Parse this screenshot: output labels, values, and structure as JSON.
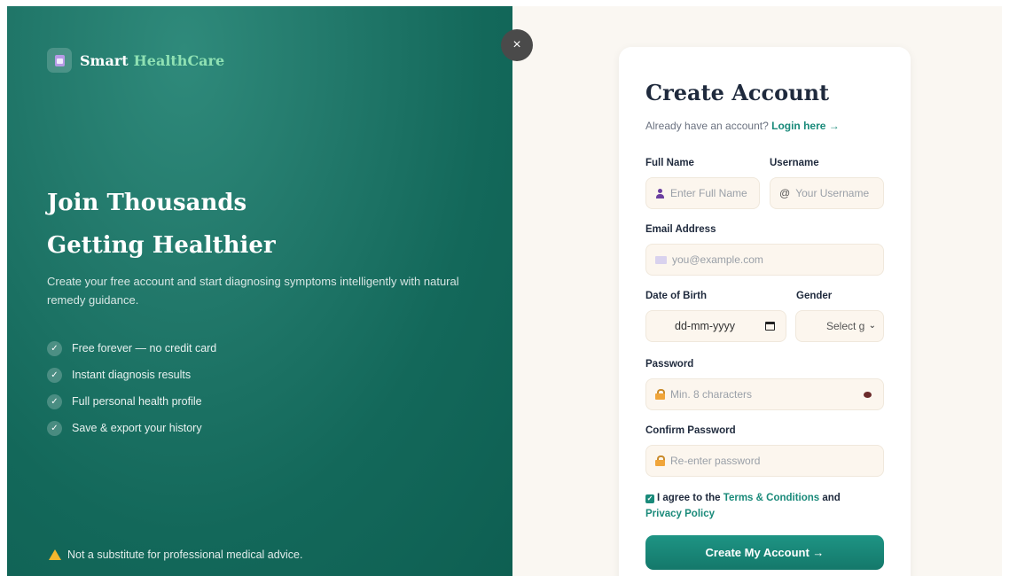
{
  "brand": {
    "name_part1": "Smart",
    "name_part2": "HealthCare"
  },
  "hero": {
    "title_line1": "Join Thousands",
    "title_line2": "Getting Healthier",
    "description": "Create your free account and start diagnosing symptoms intelligently with natural remedy guidance."
  },
  "features": [
    {
      "text": "Free forever — no credit card"
    },
    {
      "text": "Instant diagnosis results"
    },
    {
      "text": "Full personal health profile"
    },
    {
      "text": "Save & export your history"
    }
  ],
  "disclaimer": "Not a substitute for professional medical advice.",
  "close_button": "×",
  "form": {
    "title": "Create Account",
    "login_prompt": "Already have an account?",
    "login_link": "Login here →",
    "full_name": {
      "label": "Full Name",
      "placeholder": "Enter Full Name"
    },
    "username": {
      "label": "Username",
      "placeholder": "Your Username"
    },
    "email": {
      "label": "Email Address",
      "placeholder": "you@example.com"
    },
    "dob": {
      "label": "Date of Birth",
      "value": "dd-mm-yyyy"
    },
    "gender": {
      "label": "Gender",
      "value": "Select g"
    },
    "password": {
      "label": "Password",
      "placeholder": "Min. 8 characters"
    },
    "confirm_password": {
      "label": "Confirm Password",
      "placeholder": "Re-enter password"
    },
    "terms": {
      "prefix": "I agree to the",
      "terms_link": "Terms & Conditions",
      "and": "and",
      "privacy_link": "Privacy Policy"
    },
    "submit_label": "Create My Account →"
  },
  "colors": {
    "panel": "#13685a",
    "accent": "#1a8a7a",
    "brand_highlight": "#8fe1b3",
    "field_bg": "#fcf6ee"
  }
}
